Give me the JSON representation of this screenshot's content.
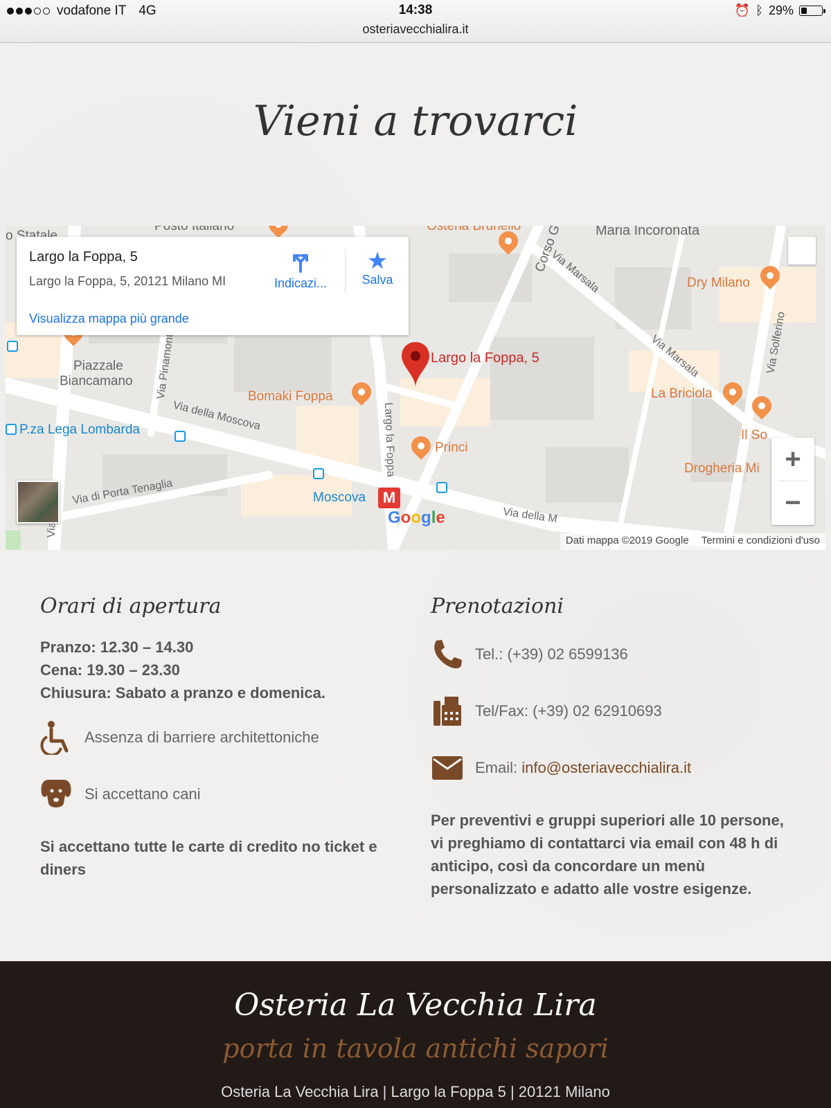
{
  "status_bar": {
    "carrier": "vodafone IT",
    "network": "4G",
    "time": "14:38",
    "url": "osteriavecchialira.it",
    "battery": "29%",
    "battery_level": 0.29
  },
  "section": {
    "title": "Vieni a trovarci"
  },
  "map": {
    "info_card": {
      "title": "Largo la Foppa, 5",
      "address": "Largo la Foppa, 5, 20121 Milano MI",
      "directions_label": "Indicazi...",
      "save_label": "Salva",
      "larger_map_link": "Visualizza mappa più grande"
    },
    "pin_label": "Largo la Foppa, 5",
    "labels": {
      "statale": "o Statale",
      "posto_italiano": "Posto Italiano",
      "osteria_brunello": "Osteria Brunello",
      "corso": "Corso G",
      "maria_incoronata": "Maria Incoronata",
      "via_marsala_1": "Via Marsala",
      "via_marsala_2": "Via Marsala",
      "dry_milano": "Dry Milano",
      "via_solferino": "Via Solferino",
      "piazzale": "Piazzale",
      "biancamano": "Biancamano",
      "via_pinamonte": "Via Pinamonte",
      "bomaki": "Bomaki Foppa",
      "largo_foppa_street": "Largo la Foppa",
      "la_briciola": "La Briciola",
      "lega_lombarda": "P.za Lega Lombarda",
      "via_moscova": "Via della Moscova",
      "princi": "Princi",
      "il_so": "Il So",
      "drogheria": "Drogheria Mi",
      "via_porta_tenaglia": "Via di Porta Tenaglia",
      "moscova": "Moscova",
      "via_moscova_2": "Via della M",
      "via_v": "Via"
    },
    "google": "Google",
    "footer": {
      "data": "Dati mappa ©2019 Google",
      "terms": "Termini e condizioni d'uso"
    },
    "zoom_in": "+",
    "zoom_out": "−"
  },
  "hours": {
    "title": "Orari di apertura",
    "lunch": "Pranzo: 12.30 – 14.30",
    "dinner": "Cena: 19.30 – 23.30",
    "closed": "Chiusura: Sabato a pranzo e domenica.",
    "accessibility": "Assenza di barriere architettoniche",
    "dogs": "Si accettano cani",
    "cards": "Si accettano tutte le carte di credito no ticket e diners"
  },
  "reservations": {
    "title": "Prenotazioni",
    "tel": "Tel.: (+39) 02 6599136",
    "telfax": "Tel/Fax: (+39) 02 62910693",
    "email_prefix": "Email:",
    "email": "info@osteriavecchialira.it",
    "groups_note": "Per preventivi e gruppi superiori alle 10 persone, vi preghiamo di contattarci via email con 48 h di anticipo, così da concordare un menù personalizzato e adatto alle vostre esigenze."
  },
  "footer": {
    "title": "Osteria La Vecchia Lira",
    "tagline": "porta in tavola antichi sapori",
    "address": "Osteria La Vecchia Lira | Largo la Foppa 5 | 20121 Milano"
  },
  "colors": {
    "accent_brown": "#7a4a28",
    "footer_bg": "#221a17",
    "map_link_blue": "#1a73e8",
    "pin_red": "#d93025"
  }
}
